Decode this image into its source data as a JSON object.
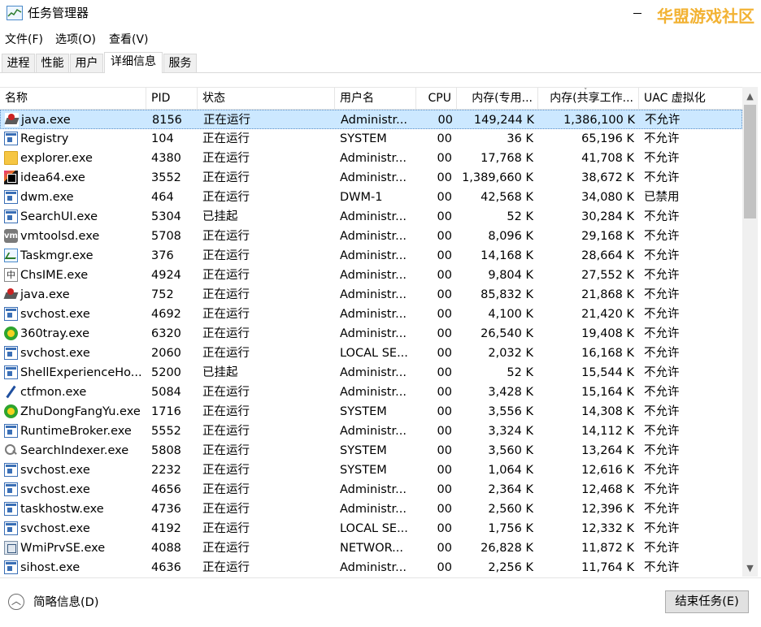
{
  "window": {
    "title": "任务管理器",
    "watermark": "华盟游戏社区"
  },
  "menu": [
    "文件(F)",
    "选项(O)",
    "查看(V)"
  ],
  "tabs": [
    {
      "label": "进程",
      "active": false
    },
    {
      "label": "性能",
      "active": false
    },
    {
      "label": "用户",
      "active": false
    },
    {
      "label": "详细信息",
      "active": true
    },
    {
      "label": "服务",
      "active": false
    }
  ],
  "columns": [
    "名称",
    "PID",
    "状态",
    "用户名",
    "CPU",
    "内存(专用...",
    "内存(共享工作...",
    "UAC 虚拟化"
  ],
  "sort_indicator": "˅",
  "rows": [
    {
      "icon": "java-icon",
      "name": "java.exe",
      "pid": "8156",
      "status": "正在运行",
      "user": "Administr...",
      "cpu": "00",
      "mem": "149,244 K",
      "shared": "1,386,100 K",
      "uac": "不允许",
      "selected": true
    },
    {
      "icon": "window-icon",
      "name": "Registry",
      "pid": "104",
      "status": "正在运行",
      "user": "SYSTEM",
      "cpu": "00",
      "mem": "36 K",
      "shared": "65,196 K",
      "uac": "不允许"
    },
    {
      "icon": "folder-icon",
      "name": "explorer.exe",
      "pid": "4380",
      "status": "正在运行",
      "user": "Administr...",
      "cpu": "00",
      "mem": "17,768 K",
      "shared": "41,708 K",
      "uac": "不允许"
    },
    {
      "icon": "intellij-icon",
      "name": "idea64.exe",
      "pid": "3552",
      "status": "正在运行",
      "user": "Administr...",
      "cpu": "00",
      "mem": "1,389,660 K",
      "shared": "38,672 K",
      "uac": "不允许"
    },
    {
      "icon": "window-icon",
      "name": "dwm.exe",
      "pid": "464",
      "status": "正在运行",
      "user": "DWM-1",
      "cpu": "00",
      "mem": "42,568 K",
      "shared": "34,080 K",
      "uac": "已禁用"
    },
    {
      "icon": "window-icon",
      "name": "SearchUI.exe",
      "pid": "5304",
      "status": "已挂起",
      "user": "Administr...",
      "cpu": "00",
      "mem": "52 K",
      "shared": "30,284 K",
      "uac": "不允许"
    },
    {
      "icon": "vmware-icon",
      "name": "vmtoolsd.exe",
      "pid": "5708",
      "status": "正在运行",
      "user": "Administr...",
      "cpu": "00",
      "mem": "8,096 K",
      "shared": "29,168 K",
      "uac": "不允许"
    },
    {
      "icon": "taskmgr-icon",
      "name": "Taskmgr.exe",
      "pid": "376",
      "status": "正在运行",
      "user": "Administr...",
      "cpu": "00",
      "mem": "14,168 K",
      "shared": "28,664 K",
      "uac": "不允许"
    },
    {
      "icon": "ime-icon",
      "name": "ChsIME.exe",
      "pid": "4924",
      "status": "正在运行",
      "user": "Administr...",
      "cpu": "00",
      "mem": "9,804 K",
      "shared": "27,552 K",
      "uac": "不允许"
    },
    {
      "icon": "java-icon",
      "name": "java.exe",
      "pid": "752",
      "status": "正在运行",
      "user": "Administr...",
      "cpu": "00",
      "mem": "85,832 K",
      "shared": "21,868 K",
      "uac": "不允许"
    },
    {
      "icon": "window-icon",
      "name": "svchost.exe",
      "pid": "4692",
      "status": "正在运行",
      "user": "Administr...",
      "cpu": "00",
      "mem": "4,100 K",
      "shared": "21,420 K",
      "uac": "不允许"
    },
    {
      "icon": "360-icon",
      "name": "360tray.exe",
      "pid": "6320",
      "status": "正在运行",
      "user": "Administr...",
      "cpu": "00",
      "mem": "26,540 K",
      "shared": "19,408 K",
      "uac": "不允许"
    },
    {
      "icon": "window-icon",
      "name": "svchost.exe",
      "pid": "2060",
      "status": "正在运行",
      "user": "LOCAL SE...",
      "cpu": "00",
      "mem": "2,032 K",
      "shared": "16,168 K",
      "uac": "不允许"
    },
    {
      "icon": "window-icon",
      "name": "ShellExperienceHo...",
      "pid": "5200",
      "status": "已挂起",
      "user": "Administr...",
      "cpu": "00",
      "mem": "52 K",
      "shared": "15,544 K",
      "uac": "不允许"
    },
    {
      "icon": "pen-icon",
      "name": "ctfmon.exe",
      "pid": "5084",
      "status": "正在运行",
      "user": "Administr...",
      "cpu": "00",
      "mem": "3,428 K",
      "shared": "15,164 K",
      "uac": "不允许"
    },
    {
      "icon": "360-icon",
      "name": "ZhuDongFangYu.exe",
      "pid": "1716",
      "status": "正在运行",
      "user": "SYSTEM",
      "cpu": "00",
      "mem": "3,556 K",
      "shared": "14,308 K",
      "uac": "不允许"
    },
    {
      "icon": "window-icon",
      "name": "RuntimeBroker.exe",
      "pid": "5552",
      "status": "正在运行",
      "user": "Administr...",
      "cpu": "00",
      "mem": "3,324 K",
      "shared": "14,112 K",
      "uac": "不允许"
    },
    {
      "icon": "search-indexer-icon",
      "name": "SearchIndexer.exe",
      "pid": "5808",
      "status": "正在运行",
      "user": "SYSTEM",
      "cpu": "00",
      "mem": "3,560 K",
      "shared": "13,264 K",
      "uac": "不允许"
    },
    {
      "icon": "window-icon",
      "name": "svchost.exe",
      "pid": "2232",
      "status": "正在运行",
      "user": "SYSTEM",
      "cpu": "00",
      "mem": "1,064 K",
      "shared": "12,616 K",
      "uac": "不允许"
    },
    {
      "icon": "window-icon",
      "name": "svchost.exe",
      "pid": "4656",
      "status": "正在运行",
      "user": "Administr...",
      "cpu": "00",
      "mem": "2,364 K",
      "shared": "12,468 K",
      "uac": "不允许"
    },
    {
      "icon": "window-icon",
      "name": "taskhostw.exe",
      "pid": "4736",
      "status": "正在运行",
      "user": "Administr...",
      "cpu": "00",
      "mem": "2,560 K",
      "shared": "12,396 K",
      "uac": "不允许"
    },
    {
      "icon": "window-icon",
      "name": "svchost.exe",
      "pid": "4192",
      "status": "正在运行",
      "user": "LOCAL SE...",
      "cpu": "00",
      "mem": "1,756 K",
      "shared": "12,332 K",
      "uac": "不允许"
    },
    {
      "icon": "wmi-icon",
      "name": "WmiPrvSE.exe",
      "pid": "4088",
      "status": "正在运行",
      "user": "NETWOR...",
      "cpu": "00",
      "mem": "26,828 K",
      "shared": "11,872 K",
      "uac": "不允许"
    },
    {
      "icon": "window-icon",
      "name": "sihost.exe",
      "pid": "4636",
      "status": "正在运行",
      "user": "Administr...",
      "cpu": "00",
      "mem": "2,256 K",
      "shared": "11,764 K",
      "uac": "不允许"
    }
  ],
  "scrollbar": {
    "up": "▲",
    "down": "▼"
  },
  "footer": {
    "less_icon": "︿",
    "less_label": "简略信息(D)",
    "end_task": "结束任务(E)"
  }
}
